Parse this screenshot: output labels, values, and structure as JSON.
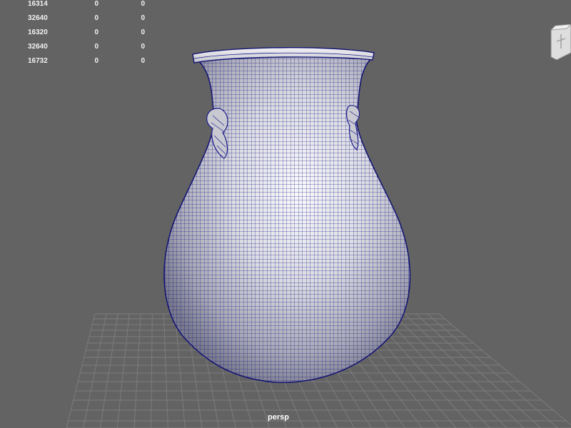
{
  "viewport": {
    "camera_label": "persp",
    "background_color": "#636363",
    "grid_color": "#7c7c7c",
    "wireframe_color": "#1c1d8c"
  },
  "hud": {
    "rows": [
      {
        "count": "16314",
        "col2": "0",
        "col3": "0"
      },
      {
        "count": "32640",
        "col2": "0",
        "col3": "0"
      },
      {
        "count": "16320",
        "col2": "0",
        "col3": "0"
      },
      {
        "count": "32640",
        "col2": "0",
        "col3": "0"
      },
      {
        "count": "16732",
        "col2": "0",
        "col3": "0"
      }
    ]
  },
  "view_cube": {
    "icon": "view-cube-icon"
  }
}
